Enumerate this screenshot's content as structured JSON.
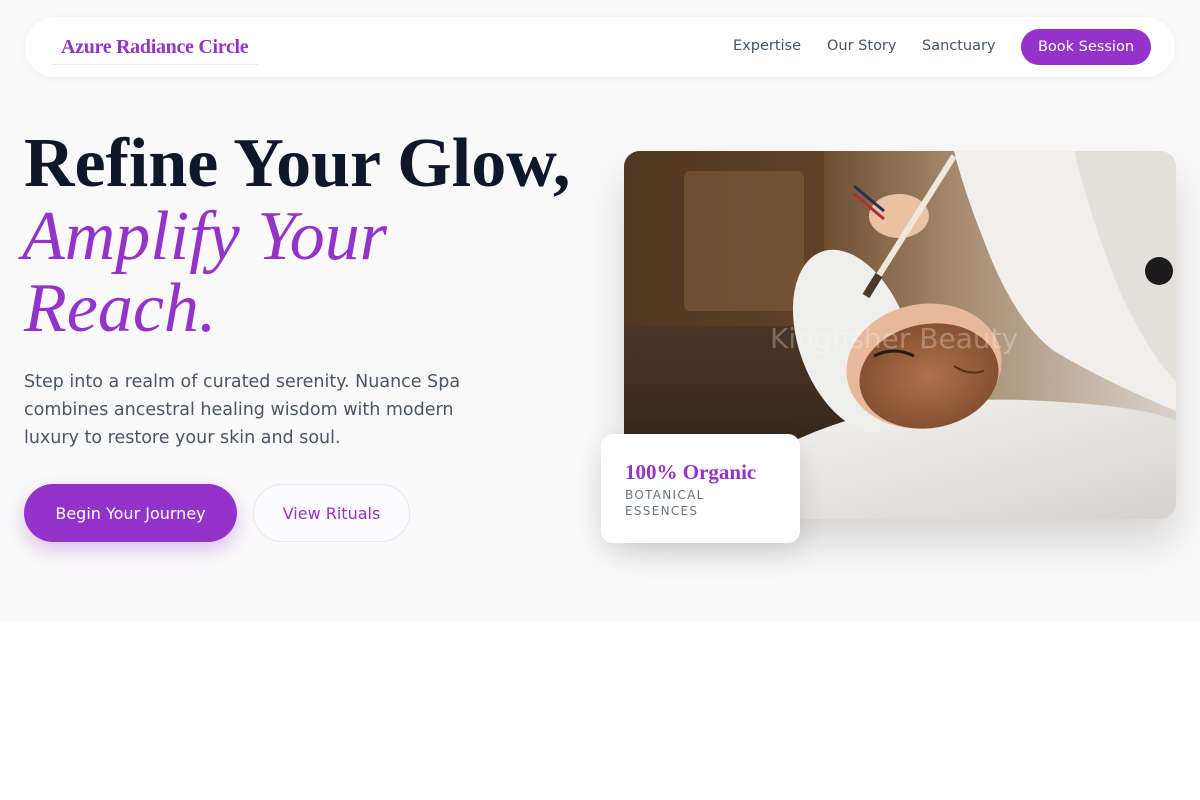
{
  "brand": {
    "name": "Azure Radiance Circle"
  },
  "nav": {
    "links": [
      "Expertise",
      "Our Story",
      "Sanctuary"
    ],
    "cta": "Book Session"
  },
  "hero": {
    "line1": "Refine Your Glow,",
    "line2": "Amplify Your",
    "line3": "Reach.",
    "intro": "Step into a realm of curated serenity. Nuance Spa combines ancestral healing wisdom with modern luxury to restore your skin and soul.",
    "primary_cta": "Begin Your Journey",
    "secondary_cta": "View Rituals"
  },
  "image": {
    "watermark": "Kingfisher Beauty",
    "subject": "facial-treatment-photo"
  },
  "badge": {
    "title": "100% Organic",
    "subtitle": "Botanical Essences"
  },
  "colors": {
    "accent": "#9333c9",
    "heading": "#0f172a",
    "body_text": "#4b5563",
    "hero_bg": "#f9f9f9"
  }
}
